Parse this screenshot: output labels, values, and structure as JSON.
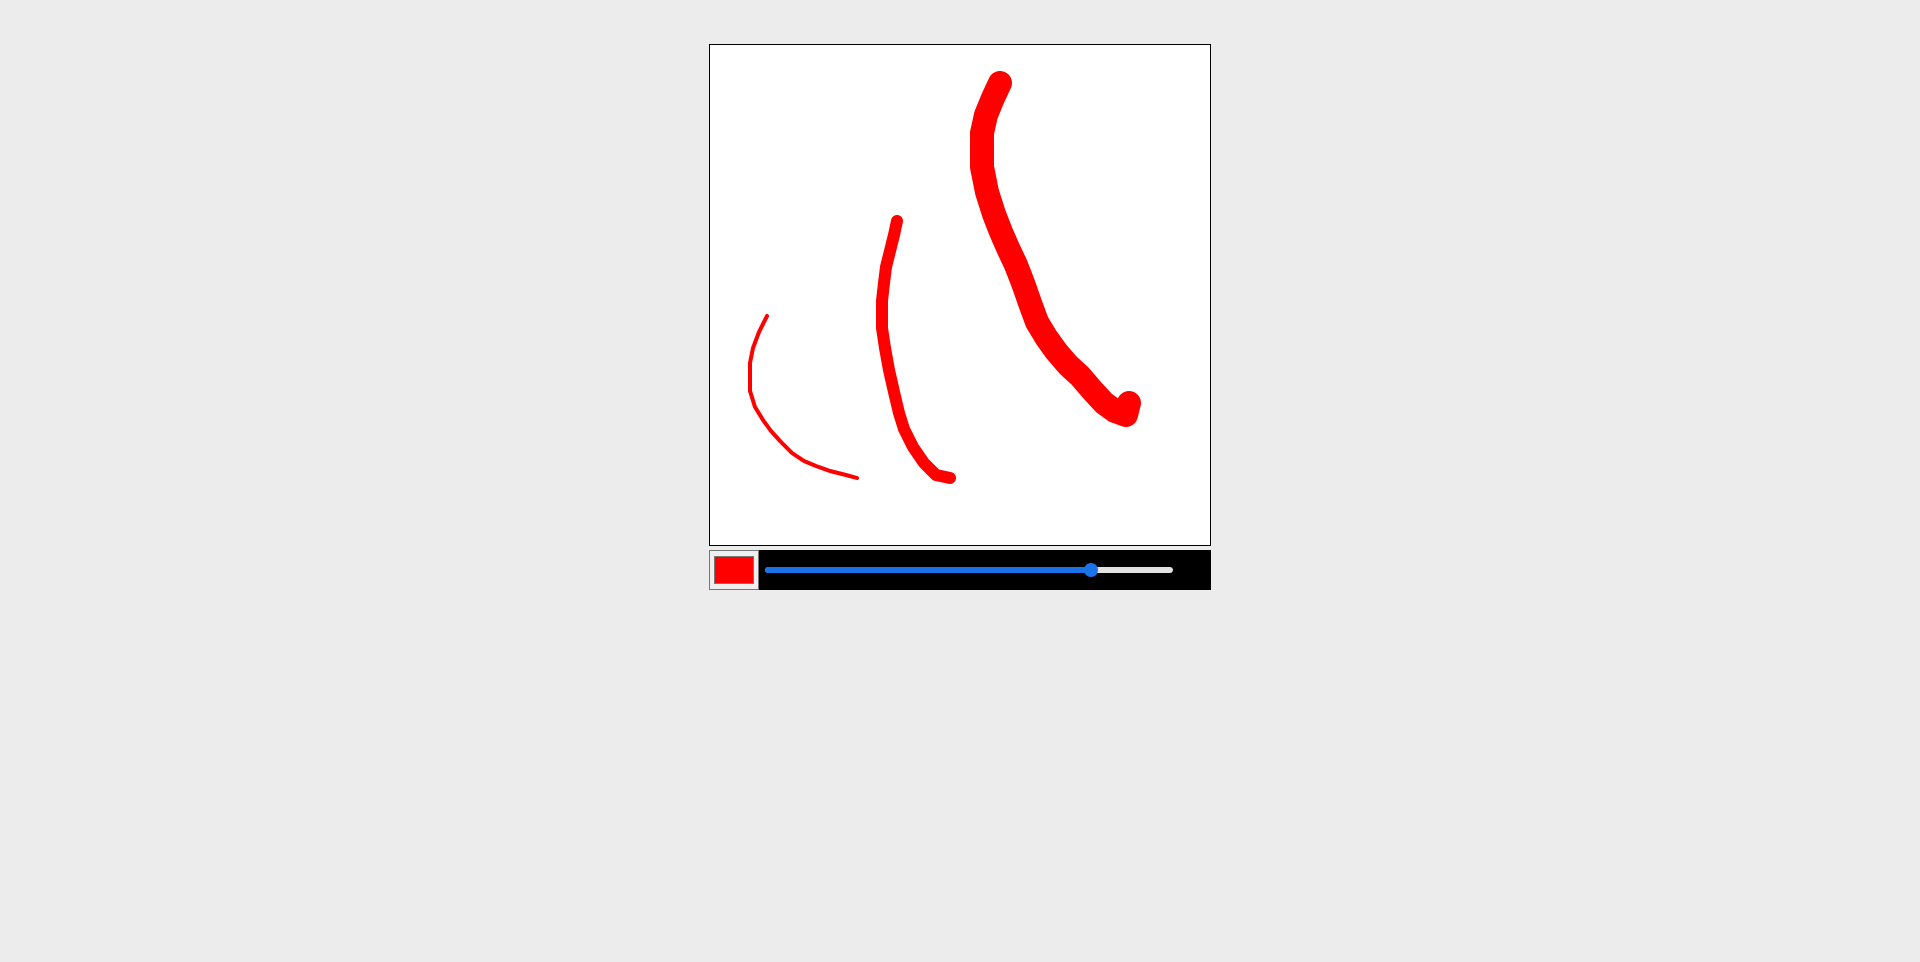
{
  "stroke_color": "#ff0000",
  "toolbar": {
    "color_value": "#ff0000",
    "brush_size": {
      "value": 80,
      "min": 0,
      "max": 100
    }
  },
  "colors": {
    "page_background": "#ececec",
    "canvas_background": "#ffffff",
    "toolbar_background": "#000000",
    "slider_accent": "#1a73e8",
    "slider_track": "#e2e2e2"
  }
}
